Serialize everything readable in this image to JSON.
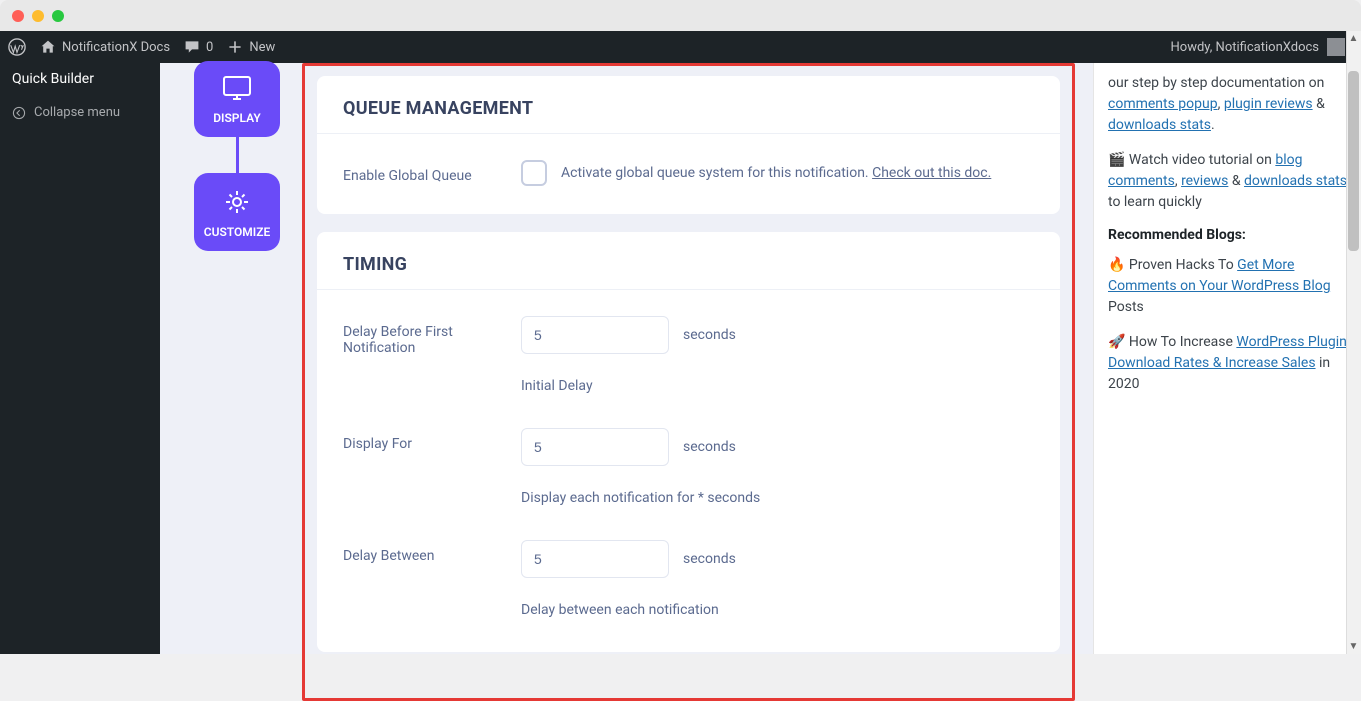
{
  "adminbar": {
    "site_title": "NotificationX Docs",
    "comments_count": "0",
    "new_label": "New",
    "howdy": "Howdy, NotificationXdocs"
  },
  "sidebar": {
    "quick_builder": "Quick Builder",
    "collapse": "Collapse menu"
  },
  "steps": {
    "display": "DISPLAY",
    "customize": "CUSTOMIZE"
  },
  "queue": {
    "heading": "QUEUE MANAGEMENT",
    "enable_label": "Enable Global Queue",
    "helper_text": "Activate global queue system for this notification. ",
    "doc_link": "Check out this doc."
  },
  "timing": {
    "heading": "TIMING",
    "delay_before_label": "Delay Before First Notification",
    "delay_before_value": "5",
    "delay_before_unit": "seconds",
    "delay_before_help": "Initial Delay",
    "display_for_label": "Display For",
    "display_for_value": "5",
    "display_for_unit": "seconds",
    "display_for_help": "Display each notification for * seconds",
    "delay_between_label": "Delay Between",
    "delay_between_value": "5",
    "delay_between_unit": "seconds",
    "delay_between_help": "Delay between each notification"
  },
  "rightbar": {
    "intro": "our step by step documentation on ",
    "link_comments_popup": "comments popup",
    "link_plugin_reviews": "plugin reviews",
    "link_downloads_stats": "downloads stats",
    "video_prefix": "Watch video tutorial on ",
    "link_blog_comments": "blog comments",
    "link_reviews": "reviews",
    "link_downloads_stats2": "downloads stats",
    "video_suffix": " to learn quickly",
    "recommended_heading": "Recommended Blogs:",
    "blog1_prefix": "Proven Hacks To ",
    "blog1_link": "Get More Comments on Your WordPress Blog",
    "blog1_suffix": " Posts",
    "blog2_prefix": "How To Increase ",
    "blog2_link": "WordPress Plugin Download Rates & Increase Sales",
    "blog2_suffix": " in 2020"
  }
}
